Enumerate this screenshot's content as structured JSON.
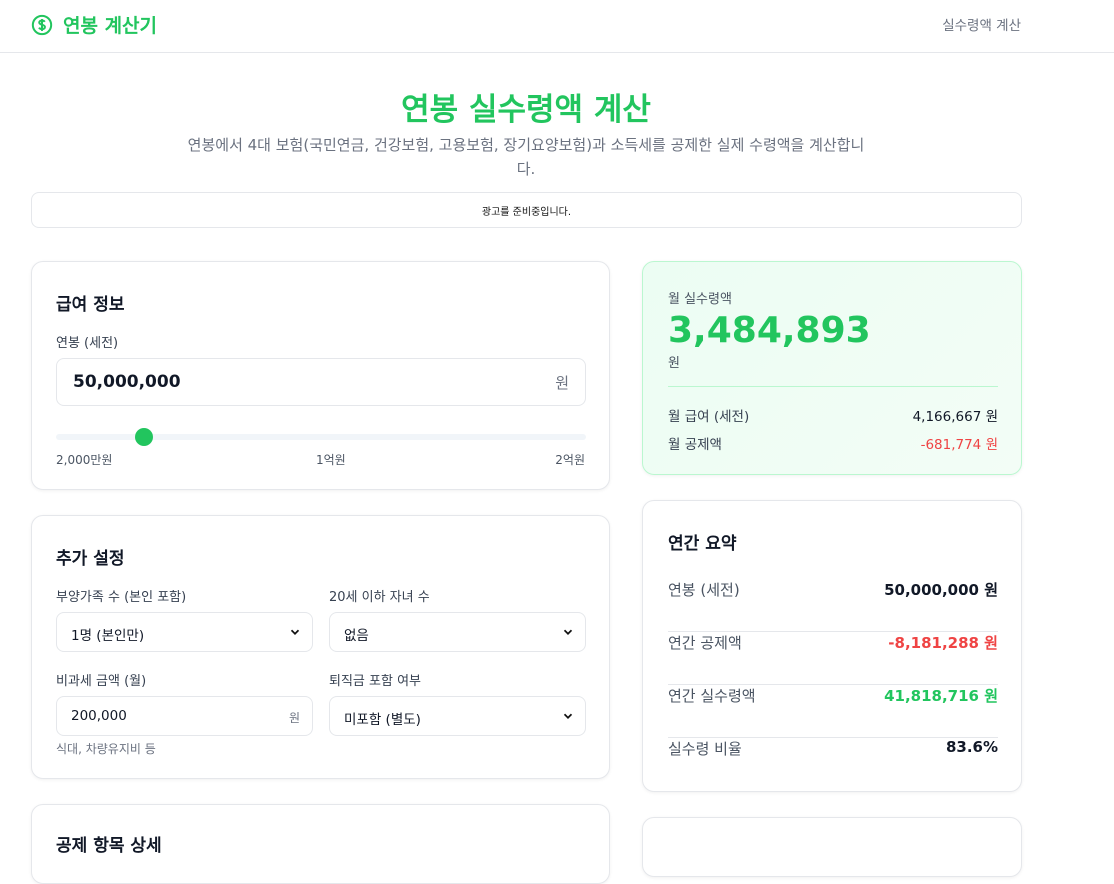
{
  "header": {
    "brand": "연봉 계산기",
    "nav_link": "실수령액 계산",
    "accent": "#22c55e"
  },
  "hero": {
    "title": "연봉 실수령액 계산",
    "description": "연봉에서 4대 보험(국민연금, 건강보험, 고용보험, 장기요양보험)과 소득세를 공제한 실제 수령액을 계산합니다."
  },
  "ad": {
    "text": "광고를 준비중입니다."
  },
  "salary": {
    "title": "급여 정보",
    "label": "연봉 (세전)",
    "value": "50,000,000",
    "unit": "원",
    "slider_fraction": 0.1667,
    "slider_min": "2,000만원",
    "slider_mid": "1억원",
    "slider_max": "2억원"
  },
  "extra": {
    "title": "추가 설정",
    "dependents_label": "부양가족 수 (본인 포함)",
    "dependents_value": "1명 (본인만)",
    "children_label": "20세 이하 자녀 수",
    "children_value": "없음",
    "nontax_label": "비과세 금액 (월)",
    "nontax_value": "200,000",
    "nontax_unit": "원",
    "nontax_hint": "식대, 차량유지비 등",
    "severance_label": "퇴직금 포함 여부",
    "severance_value": "미포함 (별도)"
  },
  "next_section": {
    "title": "공제 항목 상세"
  },
  "result": {
    "label": "월 실수령액",
    "amount": "3,484,893",
    "unit": "원",
    "monthly_gross_label": "월 급여 (세전)",
    "monthly_gross_value": "4,166,667 원",
    "monthly_deduction_label": "월 공제액",
    "monthly_deduction_value": "-681,774 원"
  },
  "annual": {
    "title": "연간 요약",
    "rows": [
      {
        "label": "연봉 (세전)",
        "value": "50,000,000 원"
      },
      {
        "label": "연간 공제액",
        "value": "-8,181,288 원"
      },
      {
        "label": "연간 실수령액",
        "value": "41,818,716 원"
      },
      {
        "label": "실수령 비율",
        "value": "83.6%"
      }
    ]
  }
}
